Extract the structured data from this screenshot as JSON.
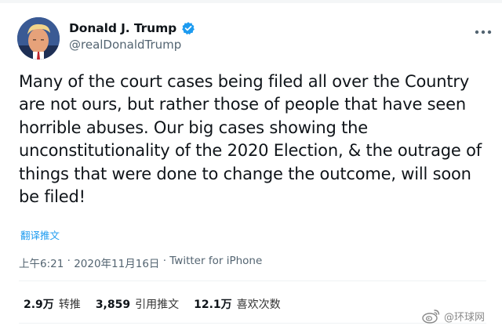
{
  "user": {
    "display_name": "Donald J. Trump",
    "handle": "@realDonaldTrump",
    "verified": true
  },
  "tweet": {
    "text": "Many of the court cases being filed all over the Country are not ours, but rather those of people that have seen horrible abuses. Our big cases showing the unconstitutionality of the 2020 Election, & the outrage of things that were done to change the outcome, will soon be filed!",
    "translate_label": "翻译推文",
    "time": "上午6:21",
    "separator": " · ",
    "date": "2020年11月16日",
    "source": "Twitter for iPhone"
  },
  "stats": [
    {
      "value": "2.9万",
      "label": "转推"
    },
    {
      "value": "3,859",
      "label": "引用推文"
    },
    {
      "value": "12.1万",
      "label": "喜欢次数"
    }
  ],
  "watermark": {
    "text": "@环球网"
  },
  "colors": {
    "link": "#1d9bf0",
    "verified": "#1d9bf0",
    "secondary_text": "#536471"
  },
  "icons": {
    "verified": "verified-badge-icon",
    "more": "more-options-icon",
    "watermark": "weibo-logo-icon"
  }
}
